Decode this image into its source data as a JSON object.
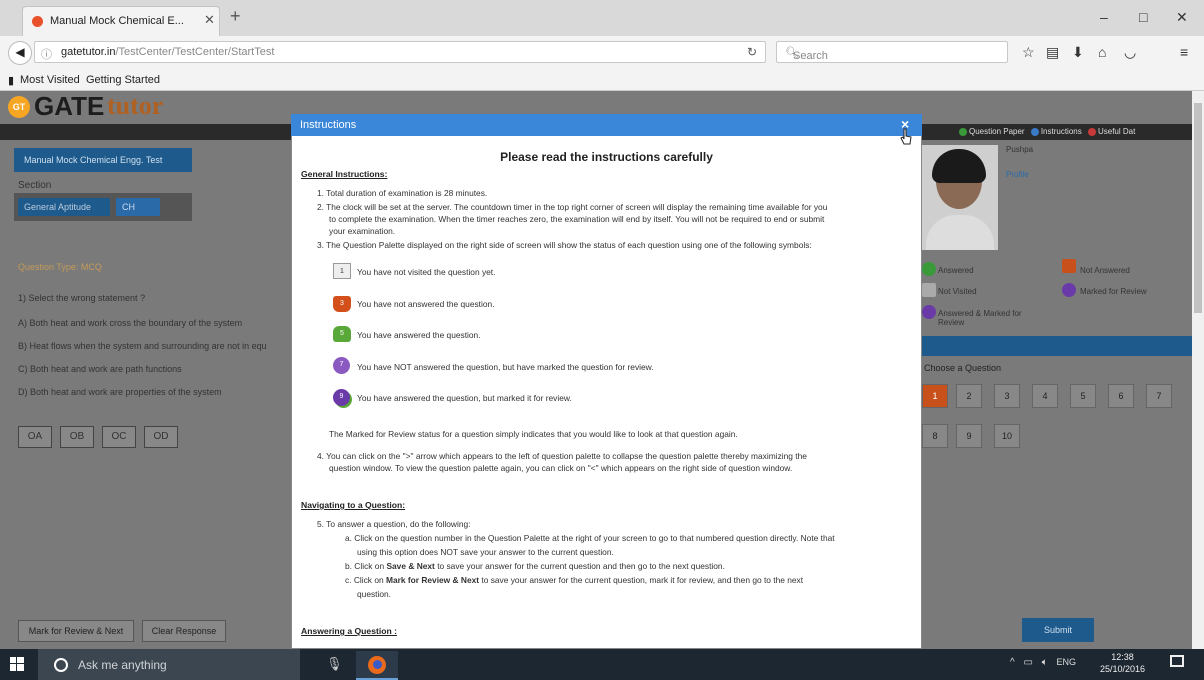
{
  "browser": {
    "tab_title": "Manual Mock Chemical E...",
    "tab_close": "✕",
    "new_tab": "+",
    "url_domain": "gatetutor.in",
    "url_path": "/TestCenter/TestCenter/StartTest",
    "search_placeholder": "Search",
    "bookmarks": [
      "Most Visited",
      "Getting Started"
    ],
    "win_controls": [
      "–",
      "□",
      "✕"
    ]
  },
  "page": {
    "logo_badge": "GT",
    "logo_gate": "GATE",
    "logo_tutor": "tutor",
    "top_links": [
      "Question Paper",
      "Instructions",
      "Useful Dat"
    ],
    "paper_button": "Manual Mock Chemical Engg. Test",
    "section_label": "Section",
    "sections": [
      "General Aptitude",
      "CH"
    ],
    "question_type": "Question Type: MCQ",
    "question": "1) Select the wrong statement ?",
    "answers": [
      "A) Both heat and work cross the boundary of the system",
      "B) Heat flows when the system and surrounding are not in equ",
      "C) Both heat and work are path functions",
      "D) Both heat and work are properties of the system"
    ],
    "option_labels": [
      "OA",
      "OB",
      "OC",
      "OD"
    ],
    "mark_review_button": "Mark for Review & Next",
    "clear_button": "Clear Response",
    "submit_button": "Submit",
    "user_name": "Pushpa",
    "profile_link": "Profile",
    "legend": [
      "Answered",
      "Not Answered",
      "Not Visited",
      "Marked for Review",
      "Answered & Marked for Review"
    ],
    "choose_question": "Choose a Question",
    "palette": [
      "1",
      "2",
      "3",
      "4",
      "5",
      "6",
      "7",
      "8",
      "9",
      "10"
    ]
  },
  "modal": {
    "title": "Instructions",
    "close": "×",
    "heading": "Please read the instructions carefully",
    "general_heading": "General Instructions:",
    "g1": "1. Total duration of examination is 28 minutes.",
    "g2a": "2. The clock will be set at the server. The countdown timer in the top right corner of screen will display the remaining time available for you",
    "g2b": "to complete the examination. When the timer reaches zero, the examination will end by itself. You will not be required to end or submit",
    "g2c": "your examination.",
    "g3": "3. The Question Palette displayed on the right side of screen will show the status of each question using one of the following symbols:",
    "symbols": [
      {
        "num": "1",
        "text": "You have not visited the question yet."
      },
      {
        "num": "3",
        "text": "You have not answered the question."
      },
      {
        "num": "5",
        "text": "You have answered the question."
      },
      {
        "num": "7",
        "text": "You have NOT answered the question, but have marked the question for review."
      },
      {
        "num": "9",
        "text": "You have answered the question, but marked it for review."
      }
    ],
    "review_note": "The Marked for Review status for a question simply indicates that you would like to look at that question again.",
    "g4a": "4. You can click on the \">\" arrow which appears to the left of question palette to collapse the question palette thereby maximizing the",
    "g4b": "question window. To view the question palette again, you can click on \"<\" which appears on the right side of question window.",
    "nav_heading": "Navigating to a Question:",
    "n5": "5. To answer a question, do the following:",
    "n5a1": "a. Click on the question number in the Question Palette at the right of your screen to go to that numbered question directly. Note that",
    "n5a2": "using this option does NOT save your answer to the current question.",
    "n5b_pre": "b. Click on",
    "n5b_bold": "Save & Next",
    "n5b_post": "to save your answer for the current question and then go to the next question.",
    "n5c_pre": "c. Click on",
    "n5c_bold": "Mark for Review & Next",
    "n5c_post": "to save your answer for the current question, mark it for review, and then go to the next",
    "n5c2": "question.",
    "ans_heading": "Answering a Question :"
  },
  "taskbar": {
    "search": "Ask me anything",
    "lang": "ENG",
    "time": "12:38",
    "date": "25/10/2016"
  },
  "colors": {
    "modal_header": "#3a86d8",
    "brand_blue": "#1e5a8c"
  }
}
